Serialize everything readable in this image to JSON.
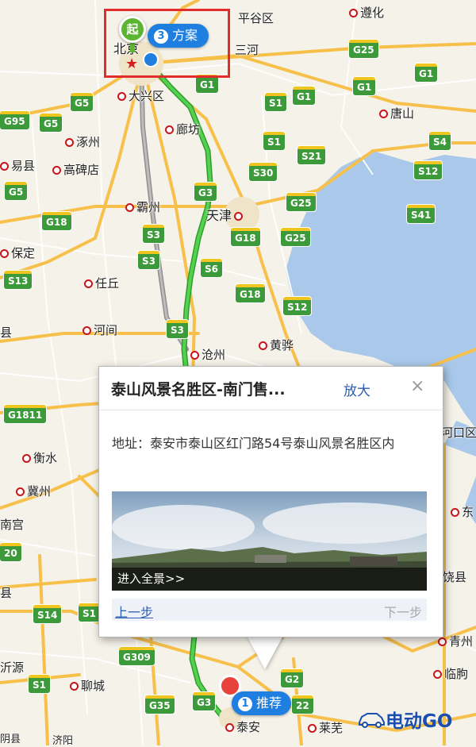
{
  "map": {
    "sea_color": "#a9c8ea",
    "land_color": "#f5f2e9",
    "route_color": "#3cbd3c",
    "alt_route_color": "#9a9a9a",
    "highway_color": "#f7c04a",
    "shield_color": "#3c9a3a",
    "city_labels": [
      {
        "key": "pinggu",
        "text": "平谷区",
        "dot": false
      },
      {
        "key": "zunhua",
        "text": "遵化",
        "dot": true
      },
      {
        "key": "beijing",
        "text": "北京",
        "dot": false
      },
      {
        "key": "sanhe",
        "text": "三河",
        "dot": false
      },
      {
        "key": "daxing",
        "text": "大兴区",
        "dot": true
      },
      {
        "key": "langfang",
        "text": "廊坊",
        "dot": true
      },
      {
        "key": "tangshan",
        "text": "唐山",
        "dot": true
      },
      {
        "key": "zhuozhou",
        "text": "涿州",
        "dot": true
      },
      {
        "key": "yixian",
        "text": "易县",
        "dot": true
      },
      {
        "key": "gaobeidian",
        "text": "高碑店",
        "dot": true
      },
      {
        "key": "bazhou",
        "text": "霸州",
        "dot": true
      },
      {
        "key": "tianjin",
        "text": "天津",
        "dot": true
      },
      {
        "key": "baoding",
        "text": "保定",
        "dot": true
      },
      {
        "key": "renqiu",
        "text": "任丘",
        "dot": true
      },
      {
        "key": "hejian",
        "text": "河间",
        "dot": true
      },
      {
        "key": "cangzhou",
        "text": "沧州",
        "dot": true
      },
      {
        "key": "huanghua",
        "text": "黄骅",
        "dot": true
      },
      {
        "key": "hengshui",
        "text": "衡水",
        "dot": true
      },
      {
        "key": "jizhou",
        "text": "冀州",
        "dot": true
      },
      {
        "key": "nangong",
        "text": "南宫",
        "dot": false
      },
      {
        "key": "liaocheng",
        "text": "聊城",
        "dot": true
      },
      {
        "key": "taian",
        "text": "泰安",
        "dot": true
      },
      {
        "key": "laiwu",
        "text": "莱芜",
        "dot": true
      },
      {
        "key": "qingzhou",
        "text": "青州",
        "dot": true
      },
      {
        "key": "linqu",
        "text": "临朐",
        "dot": true
      },
      {
        "key": "hekou",
        "text": "河口区",
        "dot": false
      },
      {
        "key": "dong",
        "text": "东",
        "dot": true
      },
      {
        "key": "raoxian",
        "text": "饶县",
        "dot": false
      },
      {
        "key": "xian1",
        "text": "县",
        "dot": false
      },
      {
        "key": "xian2",
        "text": "县",
        "dot": false
      },
      {
        "key": "yiyuan",
        "text": "沂源",
        "dot": false
      },
      {
        "key": "pinyin",
        "text": "阴县",
        "dot": false
      },
      {
        "key": "jiyang",
        "text": "济阳",
        "dot": false
      }
    ],
    "shields": [
      {
        "key": "g25a",
        "text": "G25"
      },
      {
        "key": "g1a",
        "text": "G1"
      },
      {
        "key": "g1b",
        "text": "G1"
      },
      {
        "key": "g1c",
        "text": "G1"
      },
      {
        "key": "g1d",
        "text": "G1"
      },
      {
        "key": "s1a",
        "text": "S1"
      },
      {
        "key": "s1b",
        "text": "S1"
      },
      {
        "key": "g5a",
        "text": "G5"
      },
      {
        "key": "g95",
        "text": "G95"
      },
      {
        "key": "g5b",
        "text": "G5"
      },
      {
        "key": "s4",
        "text": "S4"
      },
      {
        "key": "s21",
        "text": "S21"
      },
      {
        "key": "s30",
        "text": "S30"
      },
      {
        "key": "s12a",
        "text": "S12"
      },
      {
        "key": "g5c",
        "text": "G5"
      },
      {
        "key": "g3a",
        "text": "G3"
      },
      {
        "key": "g25b",
        "text": "G25"
      },
      {
        "key": "s41",
        "text": "S41"
      },
      {
        "key": "g18a",
        "text": "G18"
      },
      {
        "key": "s3a",
        "text": "S3"
      },
      {
        "key": "g18b",
        "text": "G18"
      },
      {
        "key": "g25c",
        "text": "G25"
      },
      {
        "key": "s3b",
        "text": "S3"
      },
      {
        "key": "s6",
        "text": "S6"
      },
      {
        "key": "s13",
        "text": "S13"
      },
      {
        "key": "g18c",
        "text": "G18"
      },
      {
        "key": "s12b",
        "text": "S12"
      },
      {
        "key": "s3c",
        "text": "S3"
      },
      {
        "key": "g1811",
        "text": "G1811"
      },
      {
        "key": "s14",
        "text": "S14"
      },
      {
        "key": "s1c",
        "text": "S1"
      },
      {
        "key": "g309",
        "text": "G309"
      },
      {
        "key": "s1d",
        "text": "S1"
      },
      {
        "key": "g35",
        "text": "G35"
      },
      {
        "key": "g3b",
        "text": "G3"
      },
      {
        "key": "g2",
        "text": "G2"
      },
      {
        "key": "g22a",
        "text": "22"
      },
      {
        "key": "g20",
        "text": "20"
      }
    ],
    "start_marker": "起",
    "plan_badge": {
      "number": "3",
      "label": "方案"
    },
    "recommend_badge": {
      "number": "1",
      "label": "推荐"
    }
  },
  "popup": {
    "title": "泰山风景名胜区-南门售...",
    "zoom_label": "放大",
    "close_label": "×",
    "address": "地址：泰安市泰山区红门路54号泰山风景名胜区内",
    "panorama_caption": "进入全景>>",
    "prev_step": "上一步",
    "next_step": "下一步"
  },
  "watermark": {
    "text": "电动GO"
  }
}
